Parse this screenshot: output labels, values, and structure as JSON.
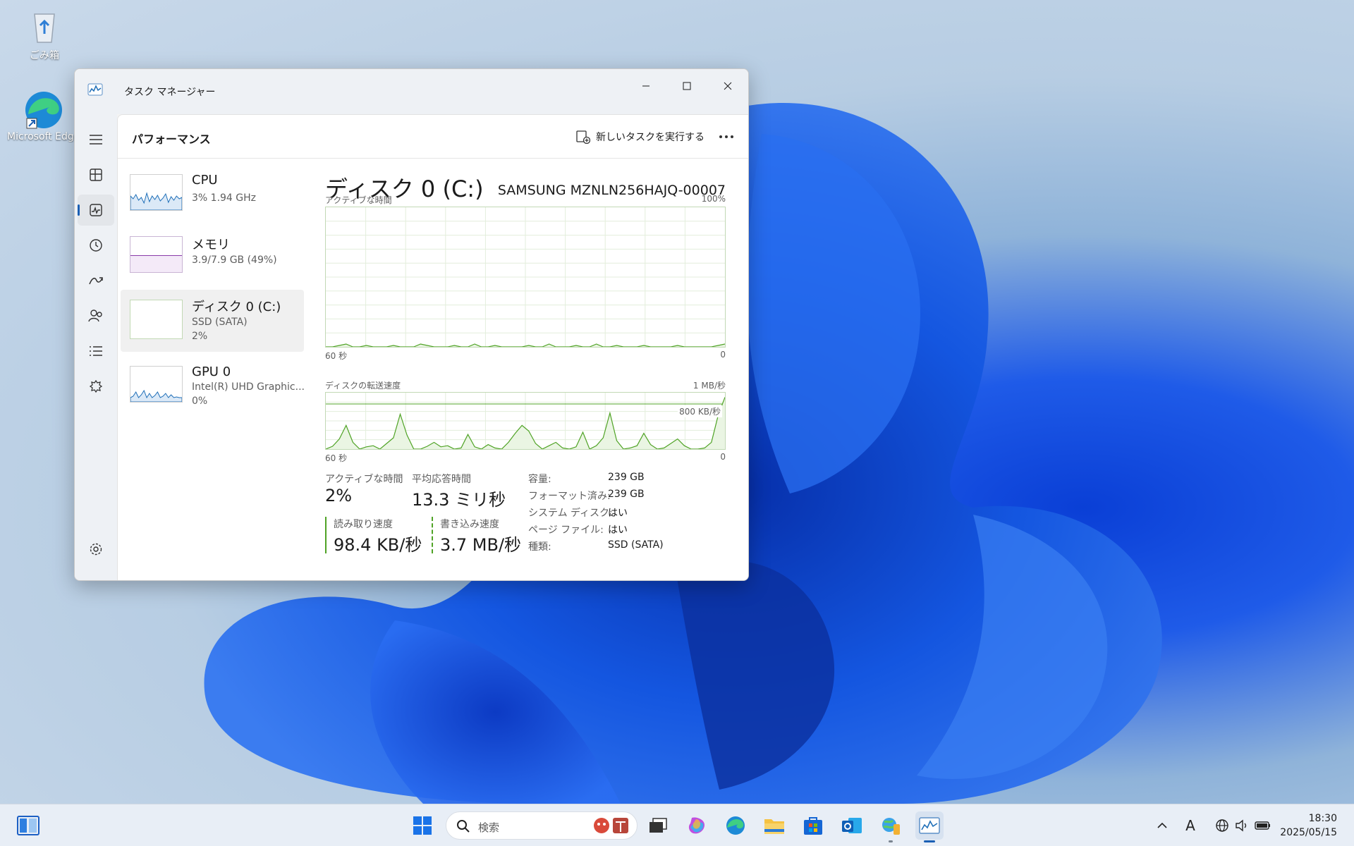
{
  "desktop": {
    "icons": [
      {
        "label": "ごみ箱",
        "icon": "recycle-bin-icon"
      },
      {
        "label": "Microsoft Edge",
        "icon": "edge-icon"
      }
    ]
  },
  "window": {
    "title": "タスク マネージャー",
    "page_title": "パフォーマンス",
    "run_task_label": "新しいタスクを実行する",
    "nav": [
      "menu-icon",
      "processes-icon",
      "performance-icon",
      "app-history-icon",
      "startup-icon",
      "users-icon",
      "details-icon",
      "services-icon",
      "settings-icon"
    ]
  },
  "devices": [
    {
      "name": "CPU",
      "line1": "3%  1.94 GHz",
      "line2": "",
      "color": "#1f6fb8"
    },
    {
      "name": "メモリ",
      "line1": "3.9/7.9 GB (49%)",
      "line2": "",
      "color": "#8a3ba8",
      "fill": 0.49
    },
    {
      "name": "ディスク 0 (C:)",
      "line1": "SSD (SATA)",
      "line2": "2%",
      "color": "#4fa325"
    },
    {
      "name": "GPU 0",
      "line1": "Intel(R) UHD Graphic...",
      "line2": "0%",
      "color": "#1f6fb8"
    }
  ],
  "detail": {
    "title": "ディスク 0 (C:)",
    "model": "SAMSUNG MZNLN256HAJQ-00007",
    "chart1": {
      "label": "アクティブな時間",
      "max_label": "100%",
      "x_left": "60 秒",
      "x_right": "0"
    },
    "chart2": {
      "label": "ディスクの転送速度",
      "max_label": "1 MB/秒",
      "mark_label": "800 KB/秒",
      "x_left": "60 秒",
      "x_right": "0"
    },
    "stats": {
      "active_label": "アクティブな時間",
      "active_value": "2%",
      "resp_label": "平均応答時間",
      "resp_value": "13.3 ミリ秒",
      "read_label": "読み取り速度",
      "read_value": "98.4 KB/秒",
      "write_label": "書き込み速度",
      "write_value": "3.7 MB/秒"
    },
    "props": [
      {
        "k": "容量:",
        "v": "239 GB"
      },
      {
        "k": "フォーマット済み:",
        "v": "239 GB"
      },
      {
        "k": "システム ディスク:",
        "v": "はい"
      },
      {
        "k": "ページ ファイル:",
        "v": "はい"
      },
      {
        "k": "種類:",
        "v": "SSD (SATA)"
      }
    ]
  },
  "chart_data": [
    {
      "type": "line",
      "title": "アクティブな時間",
      "ylim": [
        0,
        100
      ],
      "x_range": [
        "60 秒",
        "0"
      ],
      "series": [
        {
          "values": [
            0,
            0,
            1,
            2,
            0,
            0,
            1,
            0,
            0,
            0,
            1,
            0,
            0,
            0,
            2,
            1,
            0,
            0,
            0,
            1,
            0,
            0,
            2,
            0,
            0,
            1,
            0,
            0,
            0,
            0,
            1,
            0,
            0,
            2,
            0,
            0,
            0,
            1,
            0,
            0,
            2,
            0,
            0,
            1,
            0,
            0,
            0,
            1,
            0,
            0,
            0,
            0,
            1,
            0,
            0,
            0,
            0,
            0,
            1,
            2
          ]
        }
      ]
    },
    {
      "type": "line",
      "title": "ディスクの転送速度",
      "ylim": [
        0,
        1000
      ],
      "x_range": [
        "60 秒",
        "0"
      ],
      "series": [
        {
          "values": [
            0,
            50,
            180,
            420,
            120,
            0,
            40,
            60,
            0,
            100,
            200,
            620,
            250,
            0,
            0,
            50,
            120,
            40,
            60,
            0,
            20,
            260,
            40,
            0,
            80,
            20,
            0,
            120,
            280,
            420,
            320,
            100,
            0,
            60,
            120,
            20,
            0,
            40,
            300,
            0,
            60,
            200,
            640,
            150,
            0,
            20,
            60,
            280,
            80,
            0,
            20,
            100,
            180,
            60,
            0,
            0,
            20,
            120,
            600,
            920
          ]
        }
      ]
    }
  ],
  "taskbar": {
    "search_placeholder": "検索",
    "time": "18:30",
    "date": "2025/05/15",
    "ime": "A"
  }
}
